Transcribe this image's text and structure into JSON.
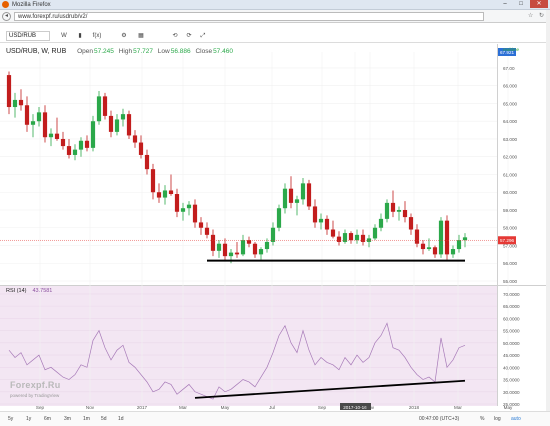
{
  "window": {
    "title": "Mozilla Firefox",
    "url": "www.forexpf.ru/usdrub/v2/"
  },
  "toolbar": {
    "symbol": "USD/RUB",
    "interval": "W",
    "buttons": [
      "f(x)",
      "⚙",
      "▦",
      "⟲",
      "⟳",
      "⤢"
    ]
  },
  "legend": {
    "symbol": "USD/RUB, W, RUB",
    "open_label": "Open",
    "open": "57.245",
    "high_label": "High",
    "high": "57.727",
    "low_label": "Low",
    "low": "56.886",
    "close_label": "Close",
    "close": "57.460"
  },
  "realtime_label": "realtime",
  "rsi": {
    "label": "RSI (14)",
    "value": "43.7581"
  },
  "watermark": "Forexpf.Ru",
  "powered": "powered by TradingView",
  "price_axis": [
    "67.00",
    "66.000",
    "65.000",
    "64.000",
    "63.000",
    "62.000",
    "61.000",
    "60.000",
    "59.000",
    "58.000",
    "57.000",
    "56.000",
    "55.000"
  ],
  "price_axis_top_badge": "67.921",
  "price_axis_current_badge": "57.296",
  "rsi_axis": [
    "70.0000",
    "65.0000",
    "60.0000",
    "55.0000",
    "50.0000",
    "45.0000",
    "40.0000",
    "35.0000",
    "30.0000",
    "25.0000"
  ],
  "time_axis": [
    "Sep",
    "Nov",
    "2017",
    "Mar",
    "May",
    "Jul",
    "Sep",
    "2017-10-16",
    "Nov",
    "2018",
    "Mar",
    "May"
  ],
  "bottom": {
    "ranges": [
      "5y",
      "1y",
      "6m",
      "3m",
      "1m",
      "5d",
      "1d"
    ],
    "time": "00:47:00 (UTC+3)",
    "pct": "%",
    "log": "log",
    "auto": "auto"
  },
  "colors": {
    "up": "#2ba84a",
    "down": "#c21d1d",
    "rsi_line": "#a77ab8",
    "rsi_bg": "#f3e6f3",
    "trend_line": "#000000",
    "current_price": "#e53935"
  },
  "chart_data": {
    "type": "candlestick",
    "series": [
      {
        "name": "USD/RUB",
        "ohlc": [
          [
            66.6,
            66.8,
            64.4,
            64.8
          ],
          [
            64.8,
            65.6,
            64.2,
            65.2
          ],
          [
            65.2,
            65.8,
            64.6,
            64.9
          ],
          [
            64.9,
            65.4,
            63.4,
            63.8
          ],
          [
            63.8,
            64.4,
            63.1,
            64.0
          ],
          [
            64.0,
            64.8,
            63.7,
            64.5
          ],
          [
            64.5,
            64.9,
            62.8,
            63.1
          ],
          [
            63.1,
            63.6,
            62.6,
            63.3
          ],
          [
            63.3,
            64.2,
            62.9,
            63.0
          ],
          [
            63.0,
            63.4,
            62.4,
            62.6
          ],
          [
            62.6,
            63.0,
            61.9,
            62.1
          ],
          [
            62.1,
            62.7,
            61.8,
            62.4
          ],
          [
            62.4,
            63.1,
            62.0,
            62.9
          ],
          [
            62.9,
            63.2,
            62.3,
            62.5
          ],
          [
            62.5,
            64.3,
            62.3,
            64.0
          ],
          [
            64.0,
            65.7,
            63.8,
            65.4
          ],
          [
            65.4,
            65.6,
            64.1,
            64.3
          ],
          [
            64.3,
            64.6,
            63.1,
            63.4
          ],
          [
            63.4,
            64.4,
            63.2,
            64.1
          ],
          [
            64.1,
            64.7,
            63.7,
            64.4
          ],
          [
            64.4,
            64.6,
            63.0,
            63.2
          ],
          [
            63.2,
            63.5,
            62.5,
            62.8
          ],
          [
            62.8,
            63.2,
            61.9,
            62.1
          ],
          [
            62.1,
            62.4,
            61.0,
            61.3
          ],
          [
            61.3,
            61.6,
            59.6,
            60.0
          ],
          [
            60.0,
            60.5,
            59.4,
            59.7
          ],
          [
            59.7,
            60.4,
            59.3,
            60.1
          ],
          [
            60.1,
            61.0,
            59.8,
            59.9
          ],
          [
            59.9,
            60.2,
            58.6,
            58.9
          ],
          [
            58.9,
            59.4,
            58.4,
            59.1
          ],
          [
            59.1,
            59.5,
            58.7,
            59.3
          ],
          [
            59.3,
            59.6,
            58.0,
            58.3
          ],
          [
            58.3,
            58.6,
            57.6,
            58.0
          ],
          [
            58.0,
            58.3,
            57.4,
            57.6
          ],
          [
            57.6,
            57.9,
            56.4,
            56.7
          ],
          [
            56.7,
            57.3,
            56.3,
            57.1
          ],
          [
            57.1,
            57.4,
            56.1,
            56.4
          ],
          [
            56.4,
            56.8,
            56.0,
            56.6
          ],
          [
            56.6,
            57.2,
            56.3,
            56.5
          ],
          [
            56.5,
            57.6,
            56.4,
            57.3
          ],
          [
            57.3,
            57.5,
            56.9,
            57.1
          ],
          [
            57.1,
            57.2,
            56.3,
            56.5
          ],
          [
            56.5,
            56.9,
            56.2,
            56.8
          ],
          [
            56.8,
            57.4,
            56.6,
            57.2
          ],
          [
            57.2,
            58.3,
            57.0,
            58.0
          ],
          [
            58.0,
            59.3,
            57.8,
            59.1
          ],
          [
            59.1,
            60.5,
            58.8,
            60.2
          ],
          [
            60.2,
            60.9,
            59.1,
            59.4
          ],
          [
            59.4,
            59.8,
            58.7,
            59.6
          ],
          [
            59.6,
            60.8,
            59.3,
            60.5
          ],
          [
            60.5,
            60.7,
            59.0,
            59.2
          ],
          [
            59.2,
            59.6,
            58.0,
            58.3
          ],
          [
            58.3,
            58.8,
            57.9,
            58.5
          ],
          [
            58.5,
            58.7,
            57.6,
            57.9
          ],
          [
            57.9,
            58.4,
            57.4,
            57.5
          ],
          [
            57.5,
            57.8,
            57.0,
            57.2
          ],
          [
            57.2,
            57.9,
            57.1,
            57.7
          ],
          [
            57.7,
            57.8,
            57.1,
            57.3
          ],
          [
            57.3,
            57.9,
            57.1,
            57.6
          ],
          [
            57.6,
            57.9,
            57.0,
            57.2
          ],
          [
            57.2,
            57.6,
            56.9,
            57.4
          ],
          [
            57.4,
            58.2,
            57.3,
            58.0
          ],
          [
            58.0,
            58.8,
            57.8,
            58.5
          ],
          [
            58.5,
            59.6,
            58.3,
            59.4
          ],
          [
            59.4,
            60.1,
            58.6,
            58.9
          ],
          [
            58.9,
            59.2,
            58.4,
            59.0
          ],
          [
            59.0,
            59.5,
            58.3,
            58.6
          ],
          [
            58.6,
            58.8,
            57.6,
            57.9
          ],
          [
            57.9,
            58.2,
            56.9,
            57.1
          ],
          [
            57.1,
            57.3,
            56.5,
            56.8
          ],
          [
            56.8,
            57.4,
            56.7,
            56.9
          ],
          [
            56.9,
            57.0,
            56.3,
            56.5
          ],
          [
            56.5,
            58.6,
            56.3,
            58.4
          ],
          [
            58.4,
            58.7,
            56.2,
            56.5
          ],
          [
            56.5,
            57.0,
            56.3,
            56.8
          ],
          [
            56.8,
            57.6,
            56.6,
            57.3
          ],
          [
            57.3,
            57.7,
            56.9,
            57.46
          ]
        ]
      }
    ],
    "rsi_values": [
      47,
      44,
      46,
      41,
      43,
      45,
      39,
      40,
      38,
      36,
      35,
      37,
      41,
      40,
      51,
      55,
      48,
      43,
      47,
      49,
      42,
      40,
      37,
      34,
      30,
      31,
      34,
      33,
      29,
      31,
      33,
      30,
      29,
      28,
      27,
      32,
      30,
      31,
      33,
      35,
      34,
      32,
      36,
      40,
      46,
      53,
      57,
      50,
      46,
      55,
      47,
      41,
      44,
      42,
      41,
      39,
      44,
      41,
      45,
      42,
      44,
      50,
      53,
      58,
      48,
      47,
      44,
      40,
      37,
      35,
      36,
      34,
      52,
      40,
      43,
      48,
      49
    ],
    "price_range": [
      55.0,
      67.9
    ],
    "rsi_range": [
      25,
      72
    ],
    "support_line": {
      "price": 56.15
    },
    "rsi_trendline": {
      "from": 27.5,
      "to": 34.5
    },
    "current_price": 57.296
  }
}
